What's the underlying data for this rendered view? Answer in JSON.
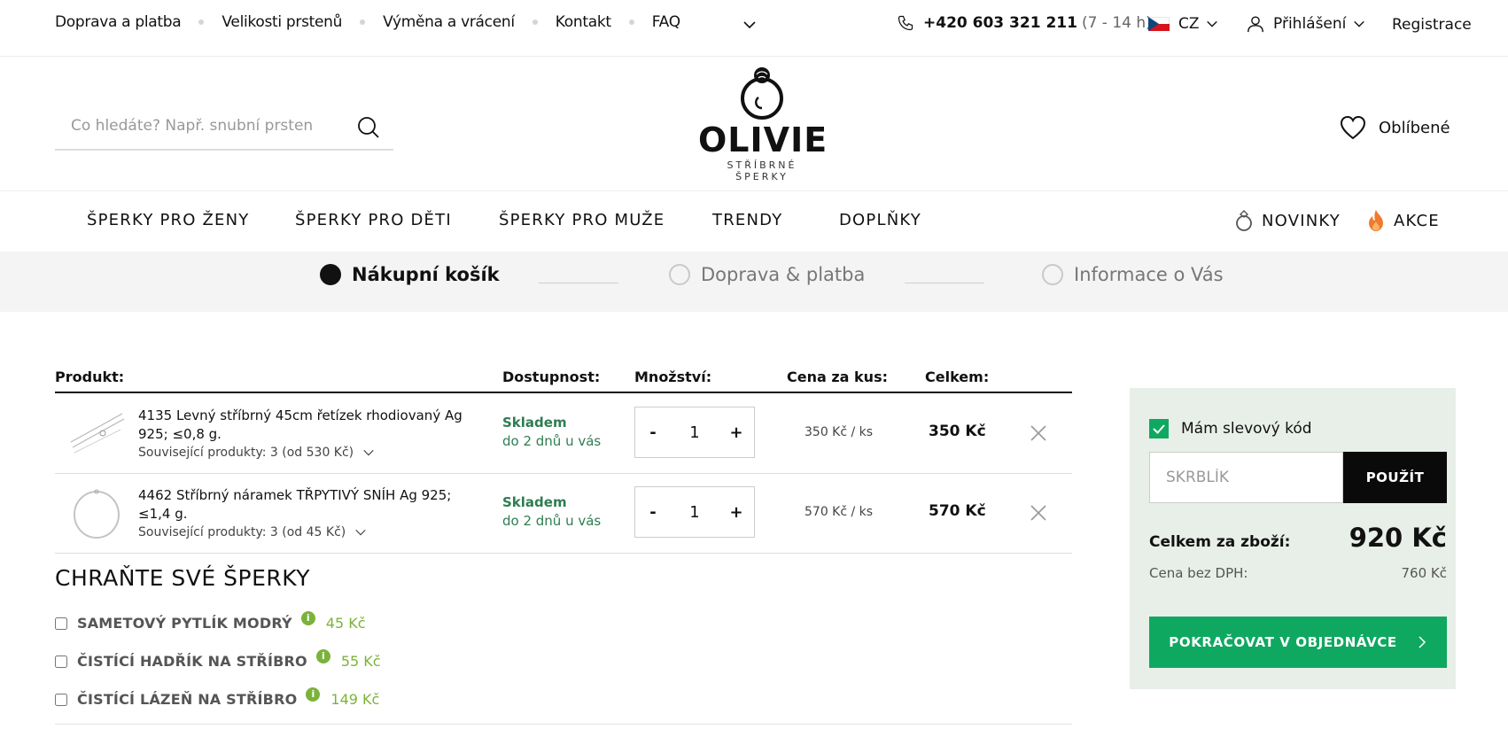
{
  "topbar": {
    "links": [
      "Doprava a platba",
      "Velikosti prstenů",
      "Výměna a vrácení",
      "Kontakt",
      "FAQ"
    ],
    "phone": "+420 603 321 211",
    "phone_hours": "(7 - 14 h)",
    "language": "CZ",
    "login": "Přihlášení",
    "register": "Registrace"
  },
  "header": {
    "search_placeholder": "Co hledáte? Např. snubní prsten",
    "logo_word": "OLIVIE",
    "logo_sub": "STŘÍBRNÉ ŠPERKY",
    "favorites": "Oblíbené"
  },
  "nav": {
    "items": [
      "ŠPERKY PRO ŽENY",
      "ŠPERKY PRO DĚTI",
      "ŠPERKY PRO MUŽE",
      "TRENDY",
      "DOPLŇKY"
    ],
    "new": "NOVINKY",
    "sale": "AKCE"
  },
  "steps": [
    "Nákupní košík",
    "Doprava & platba",
    "Informace o Vás"
  ],
  "table": {
    "headers": {
      "product": "Produkt:",
      "availability": "Dostupnost:",
      "quantity": "Množství:",
      "unit_price": "Cena za kus:",
      "total": "Celkem:"
    },
    "rows": [
      {
        "name": "4135 Levný stříbrný 45cm řetízek rhodiovaný Ag 925; ≤0,8 g.",
        "related": "Související produkty: 3 (od 530 Kč)",
        "stock": "Skladem",
        "delivery": "do 2 dnů u vás",
        "qty": "1",
        "unit_price": "350 Kč  / ks",
        "total": "350 Kč"
      },
      {
        "name": "4462 Stříbrný náramek TŘPYTIVÝ SNÍH Ag 925; ≤1,4 g.",
        "related": "Související produkty: 3 (od 45 Kč)",
        "stock": "Skladem",
        "delivery": "do 2 dnů u vás",
        "qty": "1",
        "unit_price": "570 Kč  / ks",
        "total": "570 Kč"
      }
    ]
  },
  "protect": {
    "title": "CHRAŇTE SVÉ ŠPERKY",
    "addons": [
      {
        "name": "SAMETOVÝ PYTLÍK MODRÝ",
        "price": "45 Kč"
      },
      {
        "name": "ČISTÍCÍ HADŘÍK NA STŘÍBRO",
        "price": "55 Kč"
      },
      {
        "name": "ČISTÍCÍ LÁZEŇ NA STŘÍBRO",
        "price": "149 Kč"
      }
    ]
  },
  "summary": {
    "coupon_checkbox": "Mám slevový kód",
    "coupon_value": "SKRBLÍK",
    "apply": "POUŽÍT",
    "goods_total_label": "Celkem za zboží:",
    "goods_total": "920 Kč",
    "vat_label": "Cena bez DPH:",
    "vat_value": "760 Kč",
    "continue": "POKRAČOVAT V OBJEDNÁVCE"
  },
  "colors": {
    "accent_green": "#0fa861",
    "stock_green": "#2e7d52",
    "addon_green": "#7bb33a",
    "summary_bg": "#e8efe9"
  }
}
